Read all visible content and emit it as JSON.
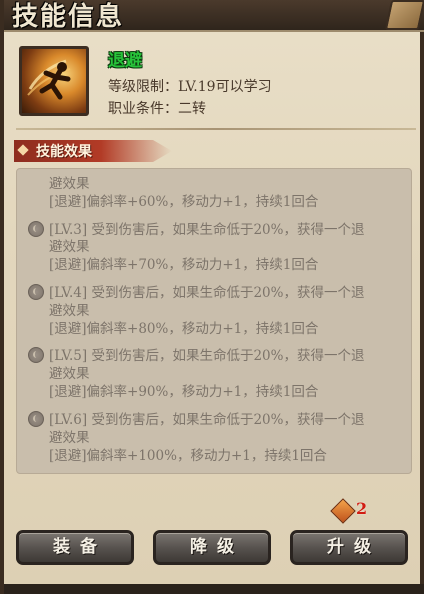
{
  "window": {
    "title": "技能信息"
  },
  "skill": {
    "name": "退避",
    "level_requirement": "等级限制：LV.19可以学习",
    "class_requirement": "职业条件：二转",
    "icon": "dodge-skill-icon"
  },
  "section": {
    "label": "技能效果"
  },
  "effects": [
    {
      "lines": [
        "避效果",
        "[退避]偏斜率+60%，移动力+1，持续1回合"
      ],
      "partial_top": true
    },
    {
      "lines": [
        "[LV.3] 受到伤害后，如果生命低于20%，获得一个退",
        "避效果",
        "[退避]偏斜率+70%，移动力+1，持续1回合"
      ]
    },
    {
      "lines": [
        "[LV.4] 受到伤害后，如果生命低于20%，获得一个退",
        "避效果",
        "[退避]偏斜率+80%，移动力+1，持续1回合"
      ]
    },
    {
      "lines": [
        "[LV.5] 受到伤害后，如果生命低于20%，获得一个退",
        "避效果",
        "[退避]偏斜率+90%，移动力+1，持续1回合"
      ]
    },
    {
      "lines": [
        "[LV.6] 受到伤害后，如果生命低于20%，获得一个退",
        "避效果",
        "[退避]偏斜率+100%，移动力+1，持续1回合"
      ]
    }
  ],
  "cost": {
    "value": "2",
    "icon": "skill-point-icon"
  },
  "buttons": {
    "equip": "装备",
    "downgrade": "降级",
    "upgrade": "升级"
  },
  "colors": {
    "skill_name": "#27c33a",
    "section_tab": "#b23b26",
    "cost": "#d11d12"
  }
}
